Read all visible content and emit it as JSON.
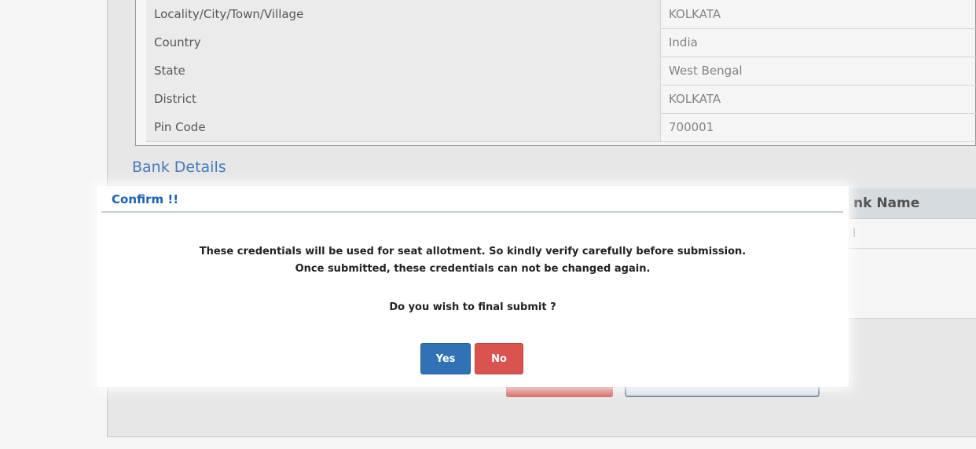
{
  "address_rows": [
    {
      "label": "Locality/City/Town/Village",
      "value": "KOLKATA"
    },
    {
      "label": "Country",
      "value": "India"
    },
    {
      "label": "State",
      "value": "West Bengal"
    },
    {
      "label": "District",
      "value": "KOLKATA"
    },
    {
      "label": "Pin Code",
      "value": "700001"
    }
  ],
  "bank": {
    "section_title": "Bank Details",
    "header_partial": "nk Name"
  },
  "modal": {
    "title": "Confirm !!",
    "message_line1": "These credentials will be used for seat allotment. So kindly verify carefully before submission.",
    "message_line2": "Once submitted, these credentials can not be changed again.",
    "question": "Do you wish to final submit ?",
    "yes_label": "Yes",
    "no_label": "No"
  },
  "colors": {
    "title_blue": "#1a5fb4",
    "yes_button": "#2f73b6",
    "no_button": "#d9534f",
    "section_title": "#4a7fc0"
  }
}
